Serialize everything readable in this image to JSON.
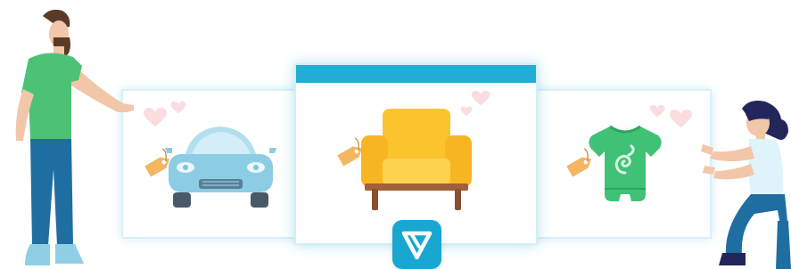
{
  "colors": {
    "header_bar": "#22aed4",
    "logo_bg": "#18a7d1",
    "card_border": "#d8f1f8",
    "heart": "#fbdde0",
    "price_tag": "#f4b661",
    "car_body": "#8dcde4",
    "armchair": "#fbc42e",
    "onesie": "#3fc275",
    "shirt": "#4dc277",
    "jeans": "#1f6ea1"
  },
  "illustration": {
    "items": [
      {
        "id": "car",
        "icon": "car-icon",
        "tag_icon": "price-tag-icon",
        "hearts": 2
      },
      {
        "id": "armchair",
        "icon": "armchair-icon",
        "tag_icon": "price-tag-icon",
        "hearts": 2
      },
      {
        "id": "baby-onesie",
        "icon": "baby-onesie-icon",
        "tag_icon": "price-tag-icon",
        "hearts": 2
      }
    ],
    "people": [
      {
        "id": "man",
        "icon": "man-figure-icon"
      },
      {
        "id": "woman",
        "icon": "woman-figure-icon"
      }
    ],
    "logo": {
      "icon": "brand-v-logo-icon"
    }
  }
}
